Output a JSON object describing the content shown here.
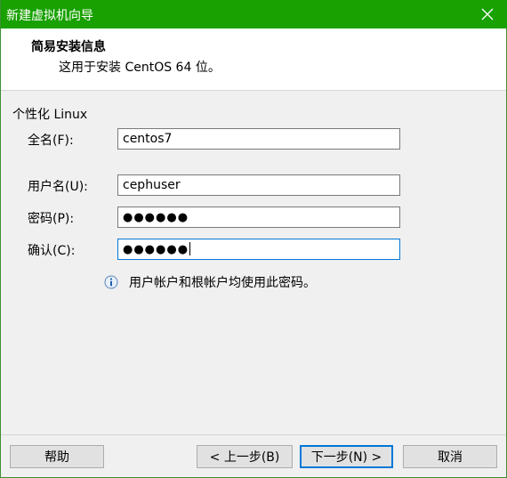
{
  "window": {
    "title": "新建虚拟机向导"
  },
  "header": {
    "title": "简易安装信息",
    "subtitle": "这用于安装 CentOS 64 位。"
  },
  "form": {
    "group_label": "个性化 Linux",
    "full_name_label": "全名(F):",
    "full_name_value": "centos7",
    "username_label": "用户名(U):",
    "username_value": "cephuser",
    "password_label": "密码(P):",
    "password_mask": "●●●●●●",
    "confirm_label": "确认(C):",
    "confirm_mask": "●●●●●●"
  },
  "info": {
    "text": "用户帐户和根帐户均使用此密码。",
    "icon": "info-icon"
  },
  "buttons": {
    "help": "帮助",
    "back": "< 上一步(B)",
    "next": "下一步(N) >",
    "cancel": "取消"
  },
  "colors": {
    "titlebar": "#18a100",
    "focus": "#0078d7",
    "dialog_bg": "#f0f0f0"
  }
}
